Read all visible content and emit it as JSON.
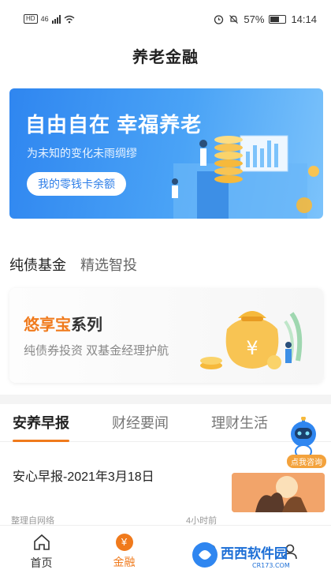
{
  "status_bar": {
    "network": "HD",
    "signal": "46",
    "battery": "57%",
    "time": "14:14"
  },
  "header": {
    "title": "养老金融"
  },
  "banner": {
    "title": "自由自在 幸福养老",
    "subtitle": "为未知的变化未雨绸缪",
    "button": "我的零钱卡余额"
  },
  "fund_tabs": [
    "纯债基金",
    "精选智投"
  ],
  "product": {
    "brand": "悠享宝",
    "suffix": "系列",
    "subtitle": "纯债券投资 双基金经理护航",
    "coin_symbol": "¥"
  },
  "news_tabs": [
    "安养早报",
    "财经要闻",
    "理财生活"
  ],
  "assistant": {
    "label": "点我咨询"
  },
  "news": {
    "title": "安心早报-2021年3月18日",
    "source": "整理自网络",
    "time": "4小时前"
  },
  "bottom_nav": {
    "home": "首页",
    "finance": "金融",
    "finance_icon": "¥"
  },
  "watermark": {
    "text": "西西软件园",
    "sub": "CR173.COM"
  },
  "colors": {
    "accent": "#f07a1c",
    "banner_blue": "#2f86f0"
  }
}
